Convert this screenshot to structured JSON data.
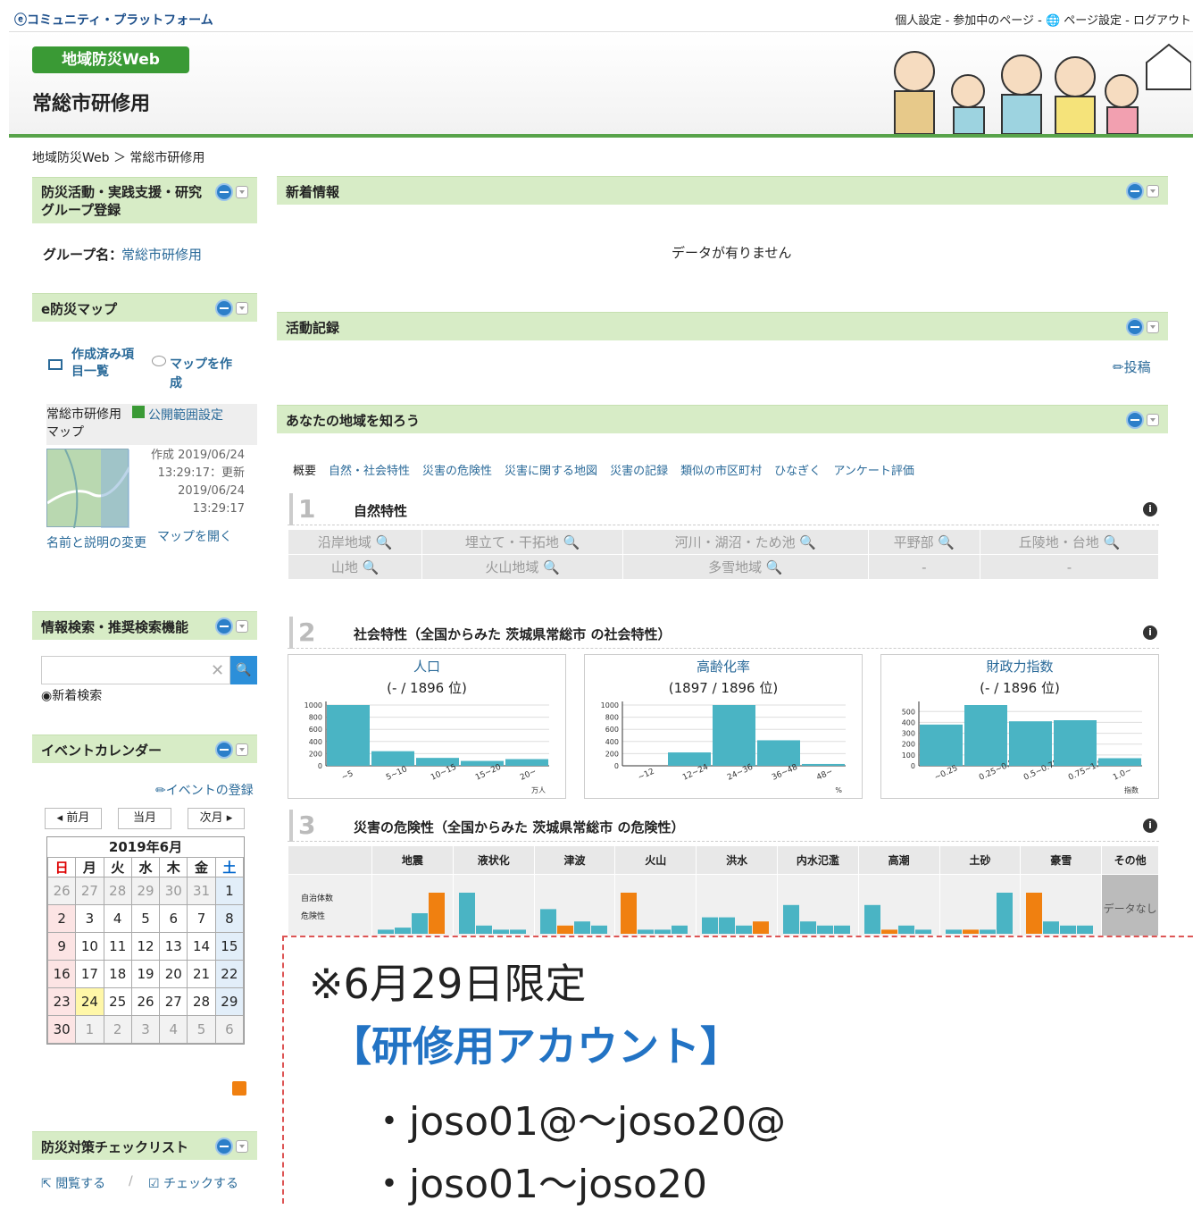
{
  "topbar": {
    "brand": "ⓔコミュニティ・プラットフォーム",
    "links": "個人設定 - 参加中のページ - 🌐 ページ設定 - ログアウト"
  },
  "header": {
    "badge": "地域防災Web",
    "title": "常総市研修用"
  },
  "breadcrumb": "地域防災Web ＞ 常総市研修用",
  "left": {
    "group_panel": {
      "title": "防災活動・実践支援・研究グループ登録",
      "name_label": "グループ名：",
      "name_value": "常総市研修用"
    },
    "map_panel": {
      "title": "e防災マップ",
      "list_label": "作成済み項目一覧",
      "create_label": "マップを作成",
      "map_name": "常総市研修用マップ",
      "publish": "公開範囲設定",
      "meta": "作成 2019/06/24 13:29:17：更新 2019/06/24 13:29:17",
      "rename": "名前と説明の変更",
      "open": "マップを開く"
    },
    "search_panel": {
      "title": "情報検索・推奨検索機能",
      "radio": "◉新着検索"
    },
    "calendar_panel": {
      "title": "イベントカレンダー",
      "register": "イベントの登録",
      "prev": "◂ 前月",
      "current": "当月",
      "next": "次月 ▸",
      "month": "2019年6月",
      "weekdays": [
        "日",
        "月",
        "火",
        "水",
        "木",
        "金",
        "土"
      ],
      "weeks": [
        [
          "26",
          "27",
          "28",
          "29",
          "30",
          "31",
          "1"
        ],
        [
          "2",
          "3",
          "4",
          "5",
          "6",
          "7",
          "8"
        ],
        [
          "9",
          "10",
          "11",
          "12",
          "13",
          "14",
          "15"
        ],
        [
          "16",
          "17",
          "18",
          "19",
          "20",
          "21",
          "22"
        ],
        [
          "23",
          "24",
          "25",
          "26",
          "27",
          "28",
          "29"
        ],
        [
          "30",
          "1",
          "2",
          "3",
          "4",
          "5",
          "6"
        ]
      ]
    },
    "checklist_panel": {
      "title": "防災対策チェックリスト",
      "view": "閲覧する",
      "sep": "/",
      "check": "チェックする"
    }
  },
  "main": {
    "news": {
      "title": "新着情報",
      "empty": "データが有りません"
    },
    "activity": {
      "title": "活動記録",
      "post": "投稿"
    },
    "know": {
      "title": "あなたの地域を知ろう",
      "tabs": [
        "概要",
        "自然・社会特性",
        "災害の危険性",
        "災害に関する地図",
        "災害の記録",
        "類似の市区町村",
        "ひなぎく",
        "アンケート評価"
      ],
      "sec1": {
        "num": "1",
        "title": "自然特性",
        "cells": [
          [
            "沿岸地域 🔍",
            "埋立て・干拓地 🔍",
            "河川・湖沼・ため池 🔍",
            "平野部 🔍",
            "丘陵地・台地 🔍"
          ],
          [
            "山地 🔍",
            "火山地域 🔍",
            "多雪地域 🔍",
            "-",
            "-"
          ]
        ]
      },
      "sec2": {
        "num": "2",
        "title": "社会特性（全国からみた 茨城県常総市 の社会特性）"
      },
      "sec3": {
        "num": "3",
        "title": "災害の危険性（全国からみた 茨城県常総市 の危険性）",
        "headers": [
          "地震",
          "液状化",
          "津波",
          "火山",
          "洪水",
          "内水氾濫",
          "高潮",
          "土砂",
          "豪雪",
          "その他"
        ],
        "nodata": "データなし",
        "axis_y": "自治体数",
        "axis_x": "危険性"
      }
    }
  },
  "chart_data": [
    {
      "type": "bar",
      "title": "人口",
      "subtitle": "(- / 1896 位)",
      "categories": [
        "~5",
        "5~10",
        "10~15",
        "15~20",
        "20~"
      ],
      "values": [
        1000,
        240,
        130,
        80,
        110
      ],
      "unit": "万人",
      "ylim": [
        0,
        1000
      ],
      "yticks": [
        0,
        200,
        400,
        600,
        800,
        1000
      ]
    },
    {
      "type": "bar",
      "title": "高齢化率",
      "subtitle": "(1897 / 1896 位)",
      "categories": [
        "~12",
        "12~24",
        "24~36",
        "36~48",
        "48~"
      ],
      "values": [
        0,
        220,
        1000,
        420,
        30
      ],
      "unit": "%",
      "ylim": [
        0,
        1000
      ],
      "yticks": [
        0,
        200,
        400,
        600,
        800,
        1000
      ]
    },
    {
      "type": "bar",
      "title": "財政力指数",
      "subtitle": "(- / 1896 位)",
      "categories": [
        "~0.25",
        "0.25~0.5",
        "0.5~0.75",
        "0.75~1.0",
        "1.0~"
      ],
      "values": [
        380,
        560,
        410,
        420,
        70
      ],
      "unit": "指数",
      "ylim": [
        0,
        560
      ],
      "yticks": [
        0,
        100,
        200,
        300,
        400,
        500
      ]
    }
  ],
  "overlay": {
    "line1": "※6月29日限定",
    "line2": "【研修用アカウント】",
    "line3": "・joso01@～joso20@",
    "line4": "・joso01～joso20"
  },
  "colors": {
    "accent_green": "#3a9a35",
    "panel_header": "#d7ecc6",
    "bar_teal": "#4ab4c4",
    "bar_orange": "#f08010",
    "overlay_blue": "#2273c4"
  }
}
